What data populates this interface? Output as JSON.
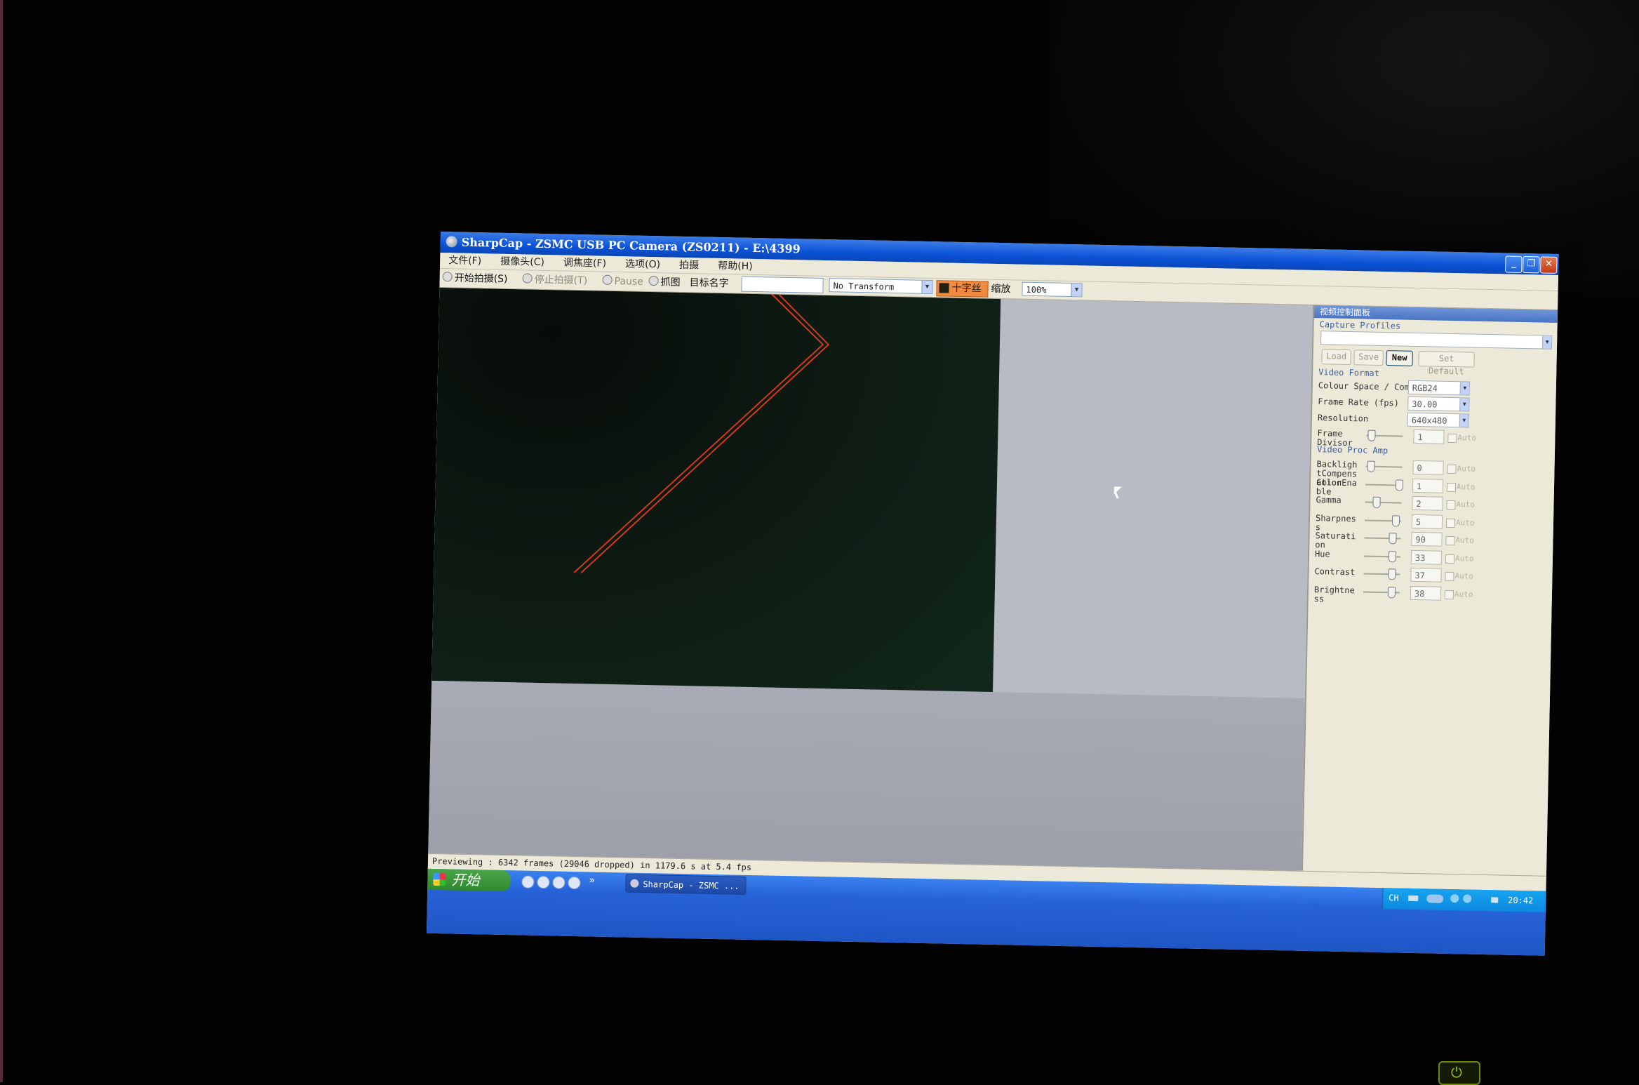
{
  "window": {
    "title": "SharpCap - ZSMC USB PC Camera (ZS0211) - E:\\4399",
    "minimize": "_",
    "maximize": "❐",
    "close": "✕"
  },
  "menu": [
    "文件(F)",
    "摄像头(C)",
    "调焦座(F)",
    "选项(O)",
    "拍摄",
    "帮助(H)"
  ],
  "toolbar": {
    "start_capture": "开始拍摄(S)",
    "stop_capture": "停止拍摄(T)",
    "pause": "Pause",
    "snapshot": "抓图",
    "target_name": "目标名字",
    "transform_value": "No Transform",
    "crosshair": "十字丝",
    "zoom_label": "缩放",
    "zoom_value": "100%"
  },
  "panel": {
    "title": "视频控制面板",
    "capture_profiles_label": "Capture Profiles",
    "profile_value": "",
    "buttons": {
      "load": "Load",
      "save": "Save",
      "new": "New",
      "set_default": "Set Default"
    },
    "video_format_label": "Video Format",
    "format_rows": [
      {
        "label": "Colour Space / Compression",
        "value": "RGB24"
      },
      {
        "label": "Frame Rate (fps)",
        "value": "30.00"
      },
      {
        "label": "Resolution",
        "value": "640x480"
      }
    ],
    "frame_divisor": {
      "label": "Frame Divisor",
      "value": "1",
      "auto": "Auto",
      "level": 0.05
    },
    "video_proc_amp_label": "Video Proc Amp",
    "controls": [
      {
        "label": "BacklightCompensation",
        "value": "0",
        "auto": "Auto",
        "level": 0.05
      },
      {
        "label": "ColorEnable",
        "value": "1",
        "auto": "Auto",
        "level": 1.0
      },
      {
        "label": "Gamma",
        "value": "2",
        "auto": "Auto",
        "level": 0.25
      },
      {
        "label": "Sharpness",
        "value": "5",
        "auto": "Auto",
        "level": 0.9
      },
      {
        "label": "Saturation",
        "value": "90",
        "auto": "Auto",
        "level": 0.82
      },
      {
        "label": "Hue",
        "value": "33",
        "auto": "Auto",
        "level": 0.82
      },
      {
        "label": "Contrast",
        "value": "37",
        "auto": "Auto",
        "level": 0.82
      },
      {
        "label": "Brightness",
        "value": "38",
        "auto": "Auto",
        "level": 0.82
      }
    ]
  },
  "status": {
    "text": "Previewing : 6342 frames (29046 dropped) in 1179.6 s at 5.4 fps"
  },
  "taskbar": {
    "start": "开始",
    "task_button": "SharpCap - ZSMC ...",
    "chevron": "»",
    "tray_lang": "CH",
    "clock": "20:42"
  },
  "colors": {
    "crosshair": "#d23a1e",
    "titlebar": "#0b52d6",
    "taskbar": "#2763d8"
  },
  "icons": [
    "windows-flag-icon",
    "sharpcap-app-icon",
    "cursor-arrow-icon",
    "power-icon"
  ]
}
